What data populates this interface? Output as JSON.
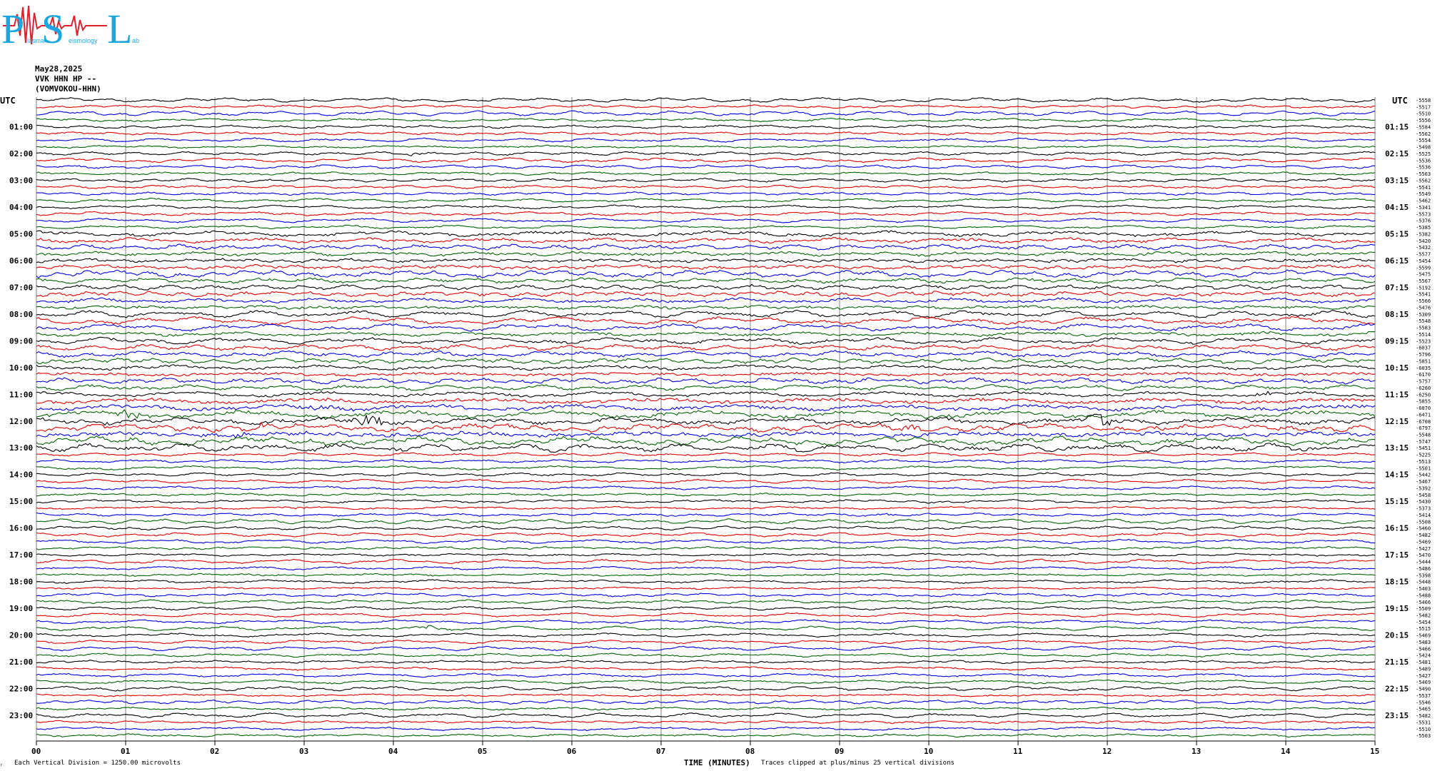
{
  "logo": {
    "big_letters": [
      "P",
      "S",
      "L"
    ],
    "small_words": [
      "lasma",
      "eismology",
      "ab"
    ]
  },
  "header": {
    "date": "May28,2025",
    "channel": "VVK HHN HP --",
    "station": "(VOMVOKOU-HHN)"
  },
  "labels": {
    "utc_left": "UTC",
    "utc_right": "UTC"
  },
  "left_hour_labels": [
    "01:00",
    "02:00",
    "03:00",
    "04:00",
    "05:00",
    "06:00",
    "07:00",
    "08:00",
    "09:00",
    "10:00",
    "11:00",
    "12:00",
    "13:00",
    "14:00",
    "15:00",
    "16:00",
    "17:00",
    "18:00",
    "19:00",
    "20:00",
    "21:00",
    "22:00",
    "23:00"
  ],
  "right_hour_labels": [
    "01:15",
    "02:15",
    "03:15",
    "04:15",
    "05:15",
    "06:15",
    "07:15",
    "08:15",
    "09:15",
    "10:15",
    "11:15",
    "12:15",
    "13:15",
    "14:15",
    "15:15",
    "16:15",
    "17:15",
    "18:15",
    "19:15",
    "20:15",
    "21:15",
    "22:15",
    "23:15"
  ],
  "right_values": [
    "-5558",
    "-5517",
    "-5510",
    "-5556",
    "-5584",
    "-5562",
    "-5554",
    "-5498",
    "-5525",
    "-5536",
    "-5536",
    "-5563",
    "-5562",
    "-5541",
    "-5549",
    "-5462",
    "-5341",
    "-5573",
    "-5376",
    "-5385",
    "-5382",
    "-5420",
    "-5432",
    "-5577",
    "-5454",
    "-5599",
    "-5475",
    "-5567",
    "-5192",
    "-5541",
    "-5566",
    "-5476",
    "-5309",
    "-5548",
    "-5583",
    "-5514",
    "-5523",
    "-6037",
    "-5796",
    "-5851",
    "-6035",
    "-6170",
    "-5757",
    "-6260",
    "-6250",
    "-5855",
    "-6070",
    "-6471",
    "-6708",
    "-6797",
    "-5548",
    "-5747",
    "-5451",
    "-5225",
    "-5513",
    "-5501",
    "-5442",
    "-5467",
    "-5392",
    "-5458",
    "-5430",
    "-5373",
    "-5414",
    "-5508",
    "-5460",
    "-5482",
    "-5469",
    "-5427",
    "-5470",
    "-5444",
    "-5486",
    "-5398",
    "-5448",
    "-5403",
    "-5488",
    "-5466",
    "-5509",
    "-5482",
    "-5454",
    "-5515",
    "-5469",
    "-5483",
    "-5466",
    "-5424",
    "-5481",
    "-5489",
    "-5427",
    "-5469",
    "-5490",
    "-5537",
    "-5546",
    "-5465",
    "-5482",
    "-5531",
    "-5510",
    "-5503"
  ],
  "footer": {
    "left_mark": "⸂",
    "scale": "Each Vertical Division = 1250.00 microvolts",
    "axis_title": "TIME (MINUTES)",
    "clip_note": "Traces clipped at plus/minus 25 vertical divisions"
  },
  "colors": {
    "trace_cycle": [
      "#000000",
      "#e00000",
      "#0000e0",
      "#006400"
    ],
    "logo_cyan": "#1aa7e0",
    "logo_red": "#e0202a",
    "grid": "#808080"
  },
  "chart_data": {
    "type": "line",
    "title": "",
    "xlabel": "TIME (MINUTES)",
    "x_ticks": [
      "00",
      "01",
      "02",
      "03",
      "04",
      "05",
      "06",
      "07",
      "08",
      "09",
      "10",
      "11",
      "12",
      "13",
      "14",
      "15"
    ],
    "xlim": [
      0,
      15
    ],
    "trace_count": 96,
    "minutes_per_trace": 15,
    "units_per_division": "1250.00 microvolts",
    "clip_divisions": 25,
    "grid": true,
    "events": [
      {
        "trace": 8,
        "minute": 4.3,
        "amp": 2,
        "color_index": 2
      },
      {
        "trace": 11,
        "minute": 5.0,
        "amp": 1.5,
        "color_index": 2
      },
      {
        "trace": 44,
        "minute": 13.8,
        "amp": 2,
        "color_index": 0
      },
      {
        "trace": 45,
        "minute": 1.0,
        "amp": 3,
        "color_index": 1
      },
      {
        "trace": 46,
        "minute": 3.2,
        "amp": 3,
        "color_index": 2
      },
      {
        "trace": 47,
        "minute": 1.0,
        "amp": 8,
        "color_index": 0
      },
      {
        "trace": 48,
        "minute": 3.7,
        "amp": 10,
        "color_index": 1
      },
      {
        "trace": 48,
        "minute": 11.9,
        "amp": 10,
        "color_index": 1
      },
      {
        "trace": 49,
        "minute": 2.5,
        "amp": 4,
        "color_index": 2
      },
      {
        "trace": 49,
        "minute": 9.8,
        "amp": 4,
        "color_index": 0
      },
      {
        "trace": 50,
        "minute": 2.3,
        "amp": 4,
        "color_index": 3
      },
      {
        "trace": 61,
        "minute": 2.9,
        "amp": 3,
        "color_index": 1
      },
      {
        "trace": 62,
        "minute": 9.6,
        "amp": 2,
        "color_index": 2
      },
      {
        "trace": 79,
        "minute": 4.4,
        "amp": 3,
        "color_index": 3
      }
    ]
  }
}
